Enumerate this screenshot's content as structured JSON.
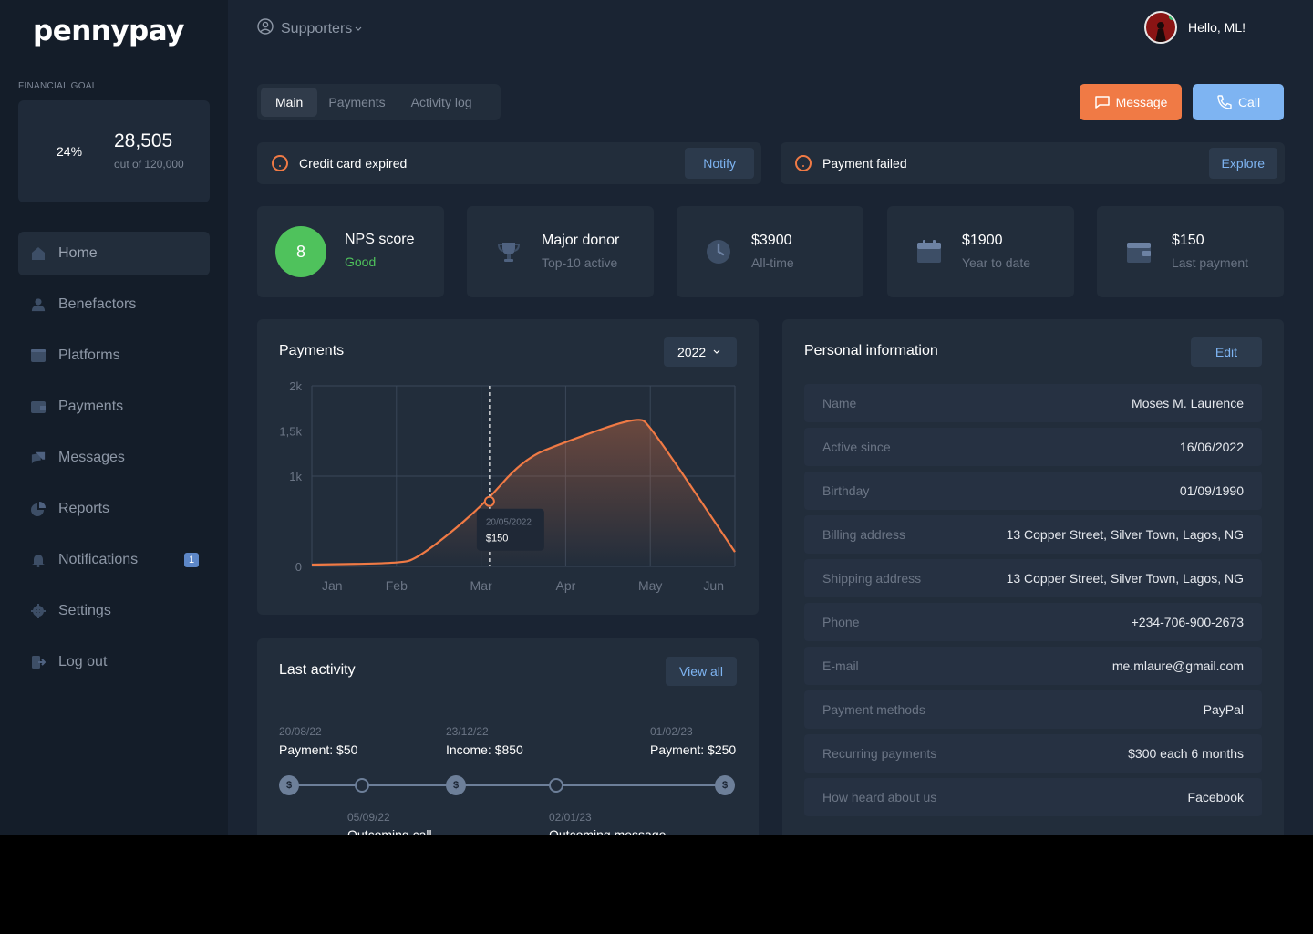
{
  "brand": {
    "logo": "pennypay"
  },
  "goal": {
    "label": "FINANCIAL GOAL",
    "percent": "24%",
    "value": "28,505",
    "sub": "out of 120,000"
  },
  "sidebar": {
    "items": [
      {
        "label": "Home",
        "icon": "home-icon",
        "active": true
      },
      {
        "label": "Benefactors",
        "icon": "users-icon"
      },
      {
        "label": "Platforms",
        "icon": "window-icon"
      },
      {
        "label": "Payments",
        "icon": "wallet-icon"
      },
      {
        "label": "Messages",
        "icon": "messages-icon"
      },
      {
        "label": "Reports",
        "icon": "pie-chart-icon"
      },
      {
        "label": "Notifications",
        "icon": "bell-icon",
        "badge": "1"
      },
      {
        "label": "Settings",
        "icon": "gear-icon"
      },
      {
        "label": "Log out",
        "icon": "logout-icon"
      }
    ]
  },
  "header": {
    "section": "Supporters",
    "greeting": "Hello, ML!"
  },
  "tabs": [
    {
      "label": "Main",
      "active": true
    },
    {
      "label": "Payments"
    },
    {
      "label": "Activity log"
    }
  ],
  "actions": {
    "message": "Message",
    "call": "Call"
  },
  "alerts": [
    {
      "text": "Credit card expired",
      "button": "Notify"
    },
    {
      "text": "Payment failed",
      "button": "Explore"
    }
  ],
  "stats": {
    "nps": {
      "value": "8",
      "title": "NPS score",
      "sub": "Good"
    },
    "cards": [
      {
        "title": "Major donor",
        "sub": "Top-10 active",
        "icon": "trophy-icon"
      },
      {
        "title": "$3900",
        "sub": "All-time",
        "icon": "clock-icon"
      },
      {
        "title": "$1900",
        "sub": "Year to date",
        "icon": "calendar-icon"
      },
      {
        "title": "$150",
        "sub": "Last payment",
        "icon": "wallet-icon"
      }
    ]
  },
  "payments_panel": {
    "title": "Payments",
    "year": "2022"
  },
  "chart_data": {
    "type": "area",
    "categories": [
      "Jan",
      "Feb",
      "Mar",
      "Apr",
      "May",
      "Jun"
    ],
    "y_ticks": [
      "0",
      "1k",
      "1,5k",
      "2k"
    ],
    "ylim": [
      0,
      2000
    ],
    "grid": true,
    "points": [
      {
        "x": 0.0,
        "y": 20
      },
      {
        "x": 1.0,
        "y": 35
      },
      {
        "x": 1.25,
        "y": 80
      },
      {
        "x": 2.0,
        "y": 650
      },
      {
        "x": 2.5,
        "y": 1190
      },
      {
        "x": 3.0,
        "y": 1380
      },
      {
        "x": 3.85,
        "y": 1660
      },
      {
        "x": 4.0,
        "y": 1560
      },
      {
        "x": 5.0,
        "y": 160
      }
    ],
    "color": "#f07a45",
    "tooltip": {
      "x": 2.1,
      "y": 720,
      "date": "20/05/2022",
      "value": "$150"
    }
  },
  "activity": {
    "title": "Last activity",
    "button": "View all",
    "items": [
      {
        "date": "20/08/22",
        "text": "Payment: $50",
        "type": "payment"
      },
      {
        "date": "05/09/22",
        "text": "Outcoming call",
        "type": "event"
      },
      {
        "date": "23/12/22",
        "text": "Income: $850",
        "type": "payment"
      },
      {
        "date": "02/01/23",
        "text": "Outcoming message",
        "type": "event"
      },
      {
        "date": "01/02/23",
        "text": "Payment: $250",
        "type": "payment"
      }
    ],
    "payment_glyph": "$"
  },
  "personal": {
    "title": "Personal information",
    "button": "Edit",
    "rows": [
      {
        "label": "Name",
        "value": "Moses M. Laurence"
      },
      {
        "label": "Active since",
        "value": "16/06/2022"
      },
      {
        "label": "Birthday",
        "value": "01/09/1990"
      },
      {
        "label": "Billing address",
        "value": "13 Copper Street, Silver Town, Lagos, NG"
      },
      {
        "label": "Shipping address",
        "value": "13 Copper Street, Silver Town, Lagos, NG"
      },
      {
        "label": "Phone",
        "value": "+234-706-900-2673"
      },
      {
        "label": "E-mail",
        "value": "me.mlaure@gmail.com"
      },
      {
        "label": "Payment methods",
        "value": "PayPal"
      },
      {
        "label": "Recurring payments",
        "value": "$300 each 6 months"
      },
      {
        "label": "How heard about us",
        "value": "Facebook"
      }
    ]
  }
}
